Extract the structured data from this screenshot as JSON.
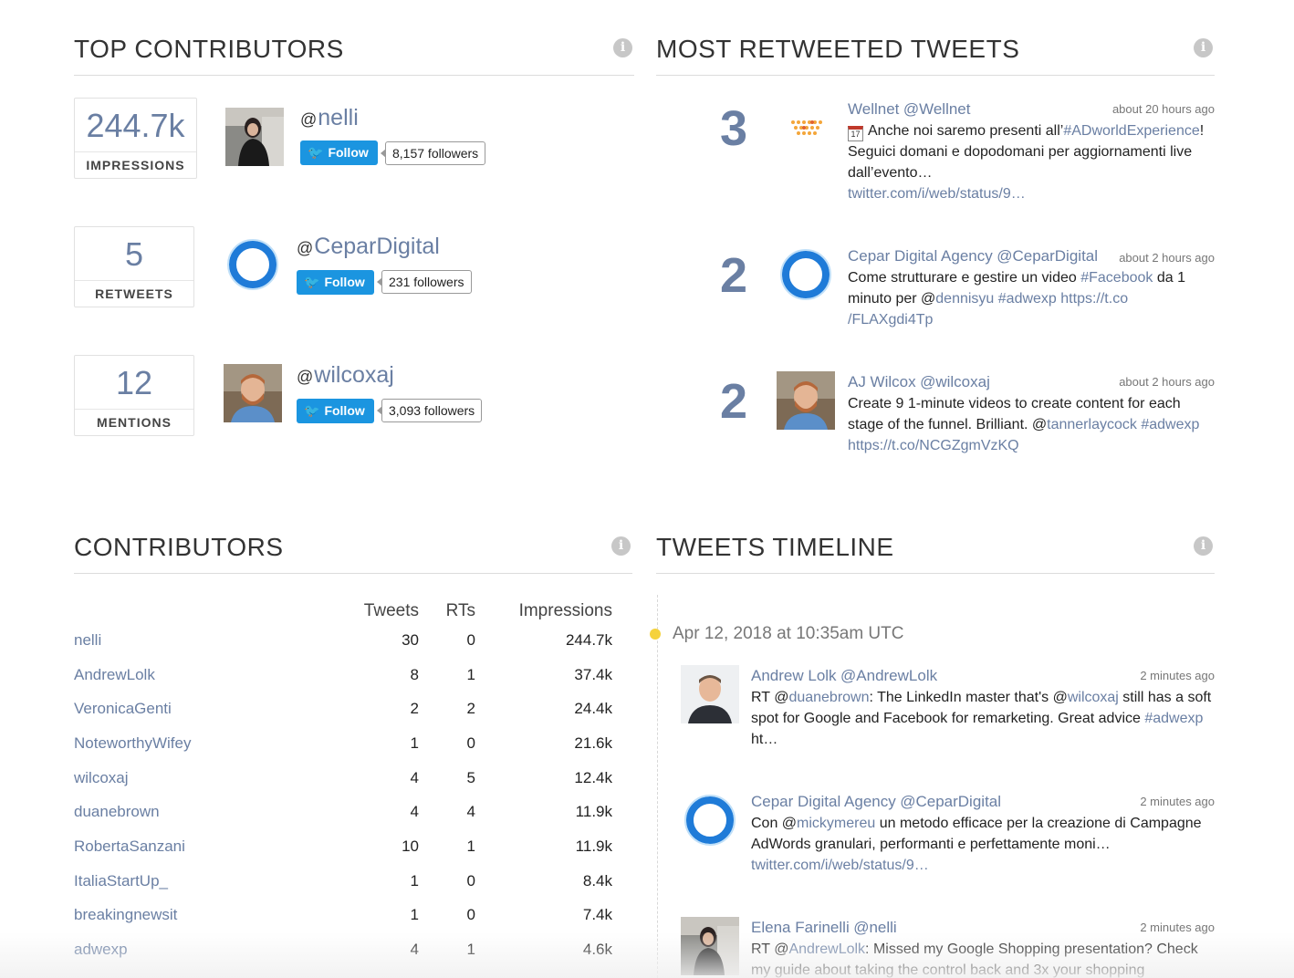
{
  "top_contributors": {
    "title": "TOP CONTRIBUTORS",
    "rows": [
      {
        "stat_value": "244.7k",
        "stat_label": "IMPRESSIONS",
        "handle": "nelli",
        "follow_label": "Follow",
        "followers": "8,157 followers"
      },
      {
        "stat_value": "5",
        "stat_label": "RETWEETS",
        "handle": "CeparDigital",
        "follow_label": "Follow",
        "followers": "231 followers"
      },
      {
        "stat_value": "12",
        "stat_label": "MENTIONS",
        "handle": "wilcoxaj",
        "follow_label": "Follow",
        "followers": "3,093 followers"
      }
    ]
  },
  "most_retweeted": {
    "title": "MOST RETWEETED TWEETS",
    "tweets": [
      {
        "count": "3",
        "name": "Wellnet",
        "handle": "@Wellnet",
        "time": "about 20 hours ago",
        "t1": "Anche noi saremo presenti all’",
        "l1": "#ADworldExperience",
        "t2": "! Seguici domani e dopodomani per aggiornamenti live dall’evento…",
        "l2": "twitter.com/i/web/status/9…"
      },
      {
        "count": "2",
        "name": "Cepar Digital Agency",
        "handle": "@CeparDigital",
        "time": "about 2 hours ago",
        "t1": "Come strutturare e gestire un video ",
        "l1": "#Facebook",
        "t2": " da 1 minuto per @",
        "l2": "dennisyu",
        "t3": " ",
        "l3": "#adwexp",
        "t4": " ",
        "l4": "https://t.co /FLAXgdi4Tp"
      },
      {
        "count": "2",
        "name": "AJ Wilcox",
        "handle": "@wilcoxaj",
        "time": "about 2 hours ago",
        "t1": "Create 9 1-minute videos to create content for each stage of the funnel. Brilliant. @",
        "l1": "tannerlaycock",
        "t2": " ",
        "l2": "#adwexp",
        "t3": " ",
        "l3": "https://t.co/NCGZgmVzKQ"
      }
    ]
  },
  "contributors": {
    "title": "CONTRIBUTORS",
    "columns": [
      "Tweets",
      "RTs",
      "Impressions"
    ],
    "rows": [
      [
        "nelli",
        "30",
        "0",
        "244.7k"
      ],
      [
        "AndrewLolk",
        "8",
        "1",
        "37.4k"
      ],
      [
        "VeronicaGenti",
        "2",
        "2",
        "24.4k"
      ],
      [
        "NoteworthyWifey",
        "1",
        "0",
        "21.6k"
      ],
      [
        "wilcoxaj",
        "4",
        "5",
        "12.4k"
      ],
      [
        "duanebrown",
        "4",
        "4",
        "11.9k"
      ],
      [
        "RobertaSanzani",
        "10",
        "1",
        "11.9k"
      ],
      [
        "ItaliaStartUp_",
        "1",
        "0",
        "8.4k"
      ],
      [
        "breakingnewsit",
        "1",
        "0",
        "7.4k"
      ],
      [
        "adwexp",
        "4",
        "1",
        "4.6k"
      ]
    ]
  },
  "timeline": {
    "title": "TWEETS TIMELINE",
    "date": "Apr 12, 2018 at 10:35am UTC",
    "tweets": [
      {
        "name": "Andrew Lolk",
        "handle": "@AndrewLolk",
        "time": "2 minutes ago",
        "t1": "RT @",
        "l1": "duanebrown",
        "t2": ": The LinkedIn master that's @",
        "l2": "wilcoxaj",
        "t3": " still has a soft spot for Google and Facebook for remarketing. Great advice ",
        "l3": "#adwexp",
        "t4": " ht…"
      },
      {
        "name": "Cepar Digital Agency",
        "handle": "@CeparDigital",
        "time": "2 minutes ago",
        "t1": "Con @",
        "l1": "mickymereu",
        "t2": " un metodo efficace per la creazione di Campagne AdWords granulari, performanti e perfettamente moni…",
        "l2": "twitter.com/i/web/status/9…"
      },
      {
        "name": "Elena Farinelli",
        "handle": "@nelli",
        "time": "2 minutes ago",
        "t1": "RT @",
        "l1": "AndrewLolk",
        "t2": ": Missed my Google Shopping presentation? Check my guide about taking the control back and 3x your shopping"
      }
    ]
  },
  "icons": {
    "info": "info-icon",
    "twitter": "twitter-bird-icon",
    "calendar": "calendar-icon"
  },
  "colors": {
    "accent": "#6a7fa3",
    "twitter_blue": "#1b95e0",
    "timeline_dot": "#f5d23c"
  }
}
